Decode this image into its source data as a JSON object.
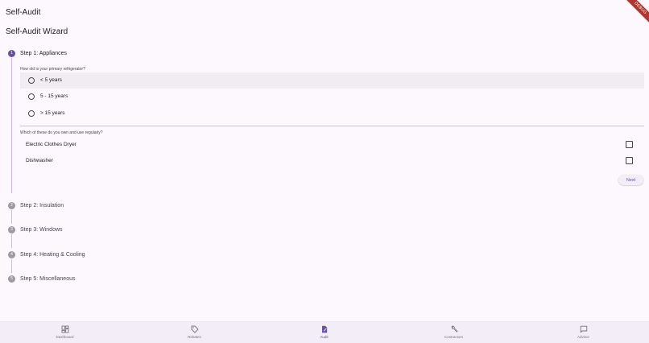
{
  "appbar": {
    "title": "Self-Audit",
    "debug_banner": "DEBUG"
  },
  "wizard": {
    "title": "Self-Audit Wizard",
    "next_label": "Next",
    "steps": [
      {
        "number": "1",
        "label": "Step 1: Appliances",
        "questions": [
          {
            "text": "How old is your primary refrigerator?",
            "options": [
              "< 5 years",
              "5 - 15 years",
              "> 15 years"
            ]
          },
          {
            "text": "Which of these do you own and use regularly?",
            "options": [
              "Electric Clothes Dryer",
              "Dishwasher"
            ]
          }
        ]
      },
      {
        "number": "2",
        "label": "Step 2: Insulation"
      },
      {
        "number": "3",
        "label": "Step 3: Windows"
      },
      {
        "number": "4",
        "label": "Step 4: Heating & Cooling"
      },
      {
        "number": "5",
        "label": "Step 5: Miscellaneous"
      }
    ]
  },
  "bottom_nav": {
    "items": [
      {
        "label": "Dashboard",
        "icon": "dashboard-icon"
      },
      {
        "label": "Rebates",
        "icon": "tag-icon"
      },
      {
        "label": "Audit",
        "icon": "audit-document-icon"
      },
      {
        "label": "Contractors",
        "icon": "wrench-icon"
      },
      {
        "label": "Advisor",
        "icon": "chat-bubble-icon"
      }
    ],
    "active_item": "Audit"
  },
  "colors": {
    "background": "#fdf7fe",
    "primary": "#6750a4",
    "inactive_step": "#9c99a2",
    "selected_row": "#f0ecf2",
    "nav_background": "#f3edf7"
  }
}
